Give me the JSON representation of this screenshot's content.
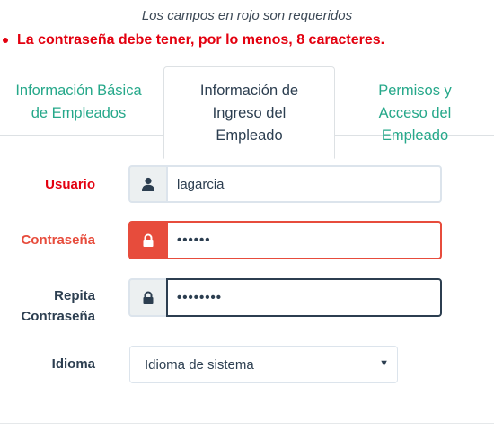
{
  "notice": "Los campos en rojo son requeridos",
  "errors": [
    "La contraseña debe tener, por lo menos, 8 caracteres."
  ],
  "tabs": [
    {
      "line1": "Información Básica",
      "line2": "de Empleados",
      "active": false
    },
    {
      "line1": "Información de",
      "line2": "Ingreso del",
      "line3": "Empleado",
      "active": true
    },
    {
      "line1": "Permisos y",
      "line2": "Acceso del",
      "line3": "Empleado",
      "active": false
    }
  ],
  "form": {
    "usuario": {
      "label": "Usuario",
      "value": "lagarcia",
      "icon": "user-icon",
      "state": "required"
    },
    "contrasena": {
      "label": "Contraseña",
      "value": "••••••",
      "icon": "lock-icon",
      "state": "error"
    },
    "repita": {
      "label_line1": "Repita",
      "label_line2": "Contraseña",
      "value": "••••••••",
      "icon": "lock-icon",
      "state": "focused"
    },
    "idioma": {
      "label": "Idioma",
      "selected": "Idioma de sistema"
    }
  },
  "colors": {
    "required": "#e3000f",
    "error": "#e74c3c",
    "link": "#26a88a",
    "text": "#2c3e50"
  }
}
